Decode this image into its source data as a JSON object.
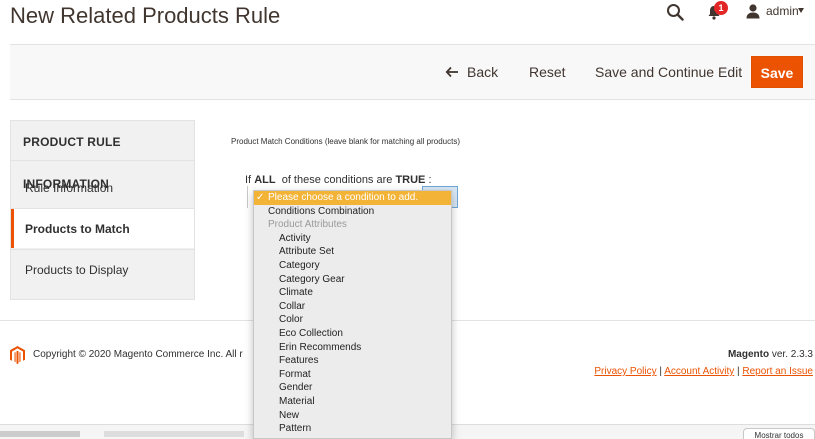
{
  "page": {
    "title": "New Related Products Rule"
  },
  "header": {
    "notification_count": "1",
    "user": "admin"
  },
  "actions": {
    "back": "Back",
    "reset": "Reset",
    "save_continue": "Save and Continue Edit",
    "save": "Save"
  },
  "tabs": {
    "title": "PRODUCT RULE INFORMATION",
    "items": [
      {
        "label": "Rule Information",
        "active": false
      },
      {
        "label": "Products to Match",
        "active": true
      },
      {
        "label": "Products to Display",
        "active": false
      }
    ]
  },
  "conditions": {
    "legend": "Product Match Conditions (leave blank for matching all products)",
    "prefix": "If",
    "aggregator": "ALL",
    "middle": "of these conditions are",
    "value": "TRUE",
    "suffix": ":"
  },
  "dropdown": {
    "selected": "Please choose a condition to add.",
    "combination": "Conditions Combination",
    "group_label": "Product Attributes",
    "attributes": [
      "Activity",
      "Attribute Set",
      "Category",
      "Category Gear",
      "Climate",
      "Collar",
      "Color",
      "Eco Collection",
      "Erin Recommends",
      "Features",
      "Format",
      "Gender",
      "Material",
      "New",
      "Pattern"
    ]
  },
  "footer": {
    "copyright": "Copyright © 2020 Magento Commerce Inc. All r",
    "brand": "Magento",
    "version": "ver. 2.3.3",
    "links": [
      "Privacy Policy",
      "Account Activity",
      "Report an Issue"
    ]
  },
  "bottom": {
    "button": "Mostrar todos"
  },
  "colors": {
    "accent": "#eb5202",
    "dropdown_highlight": "#f3b336"
  }
}
